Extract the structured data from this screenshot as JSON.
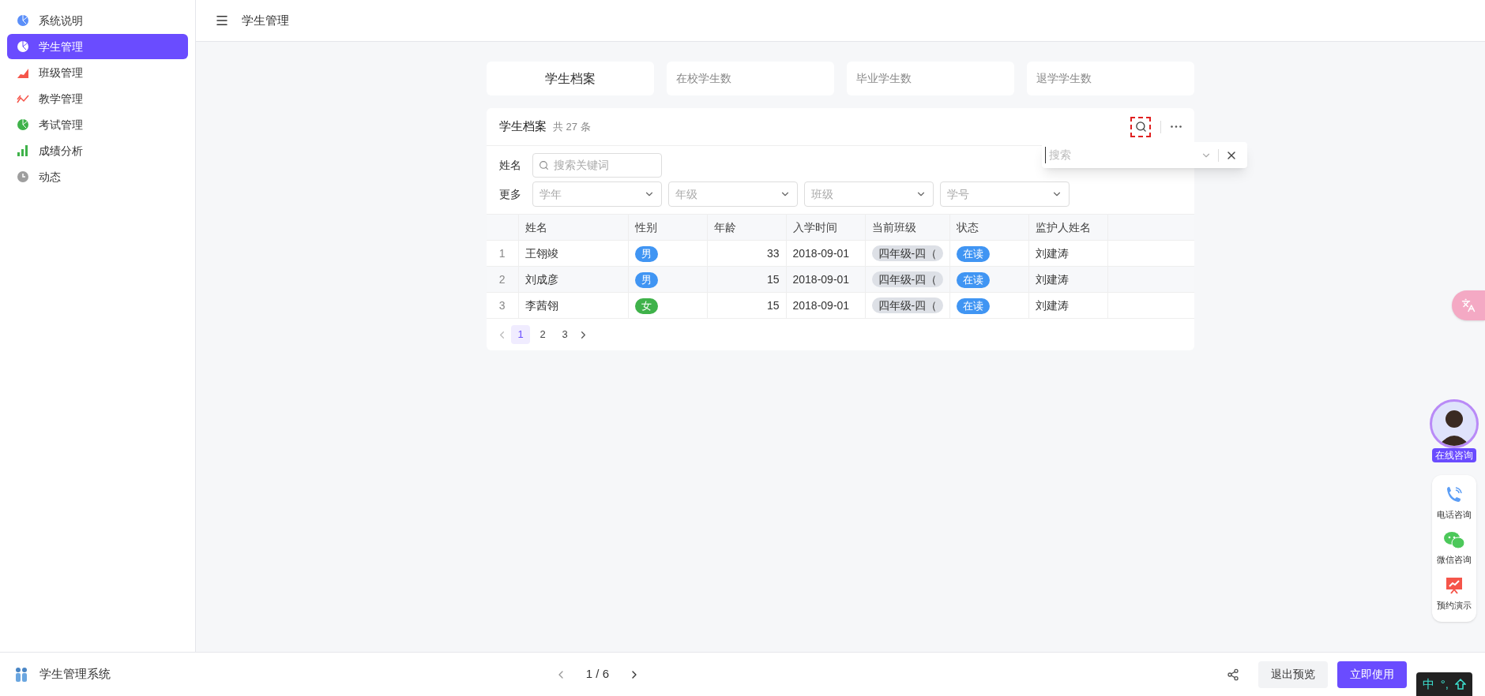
{
  "sidebar": {
    "items": [
      {
        "label": "系统说明",
        "kind": "pie",
        "color": "#5b8ff9",
        "selected": false
      },
      {
        "label": "学生管理",
        "kind": "pie",
        "color": "#ffffff",
        "selected": true
      },
      {
        "label": "班级管理",
        "kind": "area",
        "color": "#f5554a",
        "selected": false
      },
      {
        "label": "教学管理",
        "kind": "line",
        "color": "#f5554a",
        "selected": false
      },
      {
        "label": "考试管理",
        "kind": "pie",
        "color": "#3fb24a",
        "selected": false
      },
      {
        "label": "成绩分析",
        "kind": "bars",
        "color": "#3fb24a",
        "selected": false
      },
      {
        "label": "动态",
        "kind": "clock",
        "color": "#9e9e9e",
        "selected": false
      }
    ]
  },
  "header": {
    "title": "学生管理"
  },
  "stat_cards": [
    {
      "label": "学生档案",
      "selected": true
    },
    {
      "label": "在校学生数",
      "selected": false
    },
    {
      "label": "毕业学生数",
      "selected": false
    },
    {
      "label": "退学学生数",
      "selected": false
    }
  ],
  "table_card": {
    "title": "学生档案",
    "count": "共 27 条",
    "search_popup": {
      "placeholder": "搜索"
    },
    "filters": {
      "name_label": "姓名",
      "name_placeholder": "搜索关键词",
      "more_label": "更多",
      "selects": [
        "学年",
        "年级",
        "班级",
        "学号"
      ]
    },
    "columns": [
      "姓名",
      "性别",
      "年龄",
      "入学时间",
      "当前班级",
      "状态",
      "监护人姓名"
    ],
    "rows": [
      {
        "index": "1",
        "name": "王翎竣",
        "gender": "男",
        "kind": "male",
        "age": "33",
        "date": "2018-09-01",
        "class": "四年级-四（",
        "status": "在读",
        "guardian": "刘建涛"
      },
      {
        "index": "2",
        "name": "刘成彦",
        "gender": "男",
        "kind": "male",
        "age": "15",
        "date": "2018-09-01",
        "class": "四年级-四（",
        "status": "在读",
        "guardian": "刘建涛"
      },
      {
        "index": "3",
        "name": "李茜翎",
        "gender": "女",
        "kind": "female",
        "age": "15",
        "date": "2018-09-01",
        "class": "四年级-四（",
        "status": "在读",
        "guardian": "刘建涛"
      }
    ],
    "pages": [
      {
        "label": "1",
        "selected": true
      },
      {
        "label": "2",
        "selected": false
      },
      {
        "label": "3",
        "selected": false
      }
    ]
  },
  "side_widgets": {
    "avatar_label": "在线咨询",
    "items": [
      {
        "label": "电话咨询",
        "kind": "phone"
      },
      {
        "label": "微信咨询",
        "kind": "wechat"
      },
      {
        "label": "预约演示",
        "kind": "demo"
      }
    ]
  },
  "footer": {
    "app_name": "学生管理系统",
    "page": "1 / 6",
    "exit_button": "退出预览",
    "use_button": "立即使用"
  },
  "ime_bar": {
    "mode": "中",
    "punct": "°,"
  }
}
